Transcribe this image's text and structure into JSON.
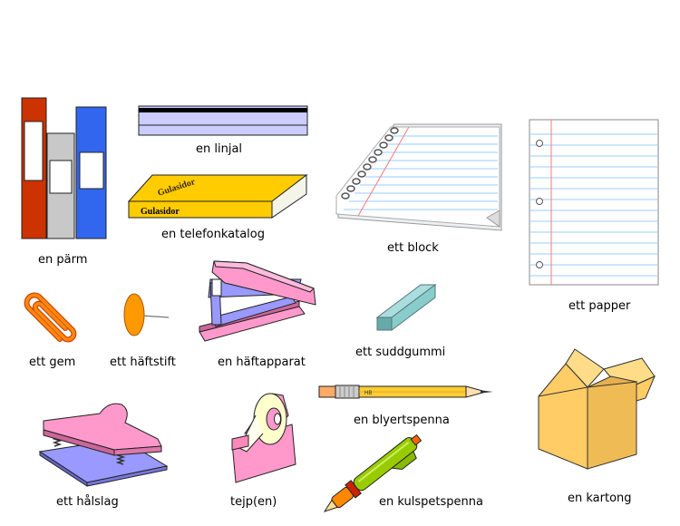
{
  "items": {
    "binders": {
      "label": "en pärm"
    },
    "ruler": {
      "label": "en linjal"
    },
    "phonebook": {
      "label": "en telefonkatalog",
      "cover_text": "Gulasidor",
      "spine_text": "Gulasidor"
    },
    "notepad": {
      "label": "ett block"
    },
    "paper": {
      "label": "ett papper"
    },
    "paperclip": {
      "label": "ett gem"
    },
    "thumbtack": {
      "label": "ett häftstift"
    },
    "stapler": {
      "label": "en häftapparat"
    },
    "eraser": {
      "label": "ett suddgummi"
    },
    "hole_punch": {
      "label": "ett hålslag"
    },
    "tape": {
      "label": "tejp(en)"
    },
    "pencil": {
      "label": "en blyertspenna",
      "grade": "HB"
    },
    "pen": {
      "label": "en kulspetspenna"
    },
    "box": {
      "label": "en kartong"
    }
  },
  "colors": {
    "binder_red": "#cc3300",
    "binder_gray": "#c8c8c8",
    "binder_blue": "#3366ee",
    "ruler_lavender": "#ccccff",
    "phonebook_yellow": "#ffcc00",
    "pink": "#ff99cc",
    "periwinkle": "#9999ff",
    "clip_orange": "#ff8811",
    "eraser_teal": "#88cccc",
    "pencil_yellow": "#ffcc33",
    "pen_green": "#99cc00",
    "box_tan": "#ffcc66",
    "line_blue": "#99ccff"
  }
}
